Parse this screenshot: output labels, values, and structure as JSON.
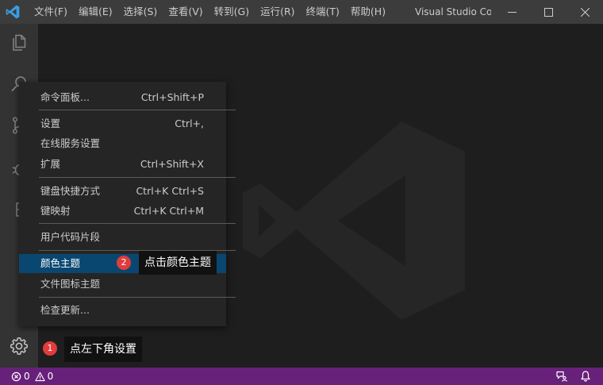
{
  "window": {
    "title": "Visual Studio Co...",
    "menu": [
      "文件(F)",
      "编辑(E)",
      "选择(S)",
      "查看(V)",
      "转到(G)",
      "运行(R)",
      "终端(T)",
      "帮助(H)"
    ]
  },
  "activity_bar": {
    "icons": [
      "files-icon",
      "search-icon",
      "source-control-icon",
      "debug-icon",
      "extensions-icon",
      "gear-icon"
    ]
  },
  "context_menu": {
    "items": [
      {
        "label": "命令面板...",
        "shortcut": "Ctrl+Shift+P"
      },
      {
        "label": "设置",
        "shortcut": "Ctrl+,"
      },
      {
        "label": "在线服务设置",
        "shortcut": ""
      },
      {
        "label": "扩展",
        "shortcut": "Ctrl+Shift+X"
      },
      {
        "label": "键盘快捷方式",
        "shortcut": "Ctrl+K Ctrl+S"
      },
      {
        "label": "键映射",
        "shortcut": "Ctrl+K Ctrl+M"
      },
      {
        "label": "用户代码片段",
        "shortcut": ""
      },
      {
        "label": "颜色主题",
        "shortcut": ""
      },
      {
        "label": "文件图标主题",
        "shortcut": ""
      },
      {
        "label": "检查更新...",
        "shortcut": ""
      }
    ],
    "active_item": "颜色主题"
  },
  "annotations": {
    "step1_number": "1",
    "step1_text": "点左下角设置",
    "step2_number": "2",
    "step2_text": "点击颜色主题"
  },
  "status_bar": {
    "errors": "0",
    "warnings": "0"
  },
  "colors": {
    "titlebar": "#3c3c3c",
    "activitybar": "#333333",
    "editor": "#1e1e1e",
    "statusbar": "#68217a",
    "menu_bg": "#252526",
    "menu_active": "#094771",
    "badge": "#e03c3c"
  }
}
